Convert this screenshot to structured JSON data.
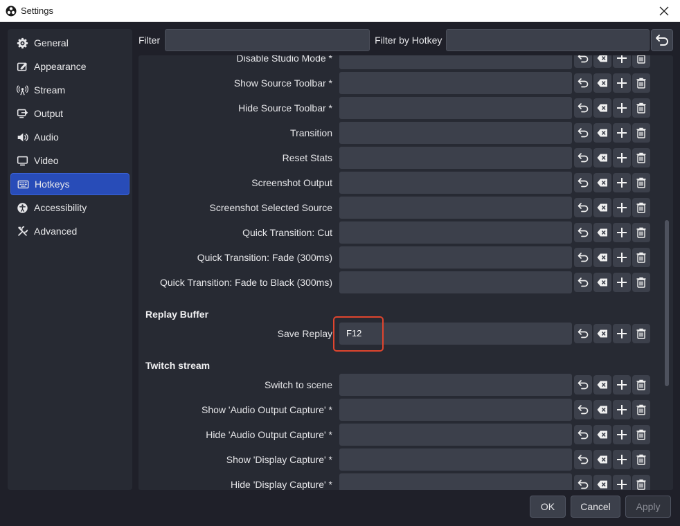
{
  "window": {
    "title": "Settings"
  },
  "sidebar": {
    "items": [
      {
        "label": "General",
        "icon": "gear-icon"
      },
      {
        "label": "Appearance",
        "icon": "appearance-icon"
      },
      {
        "label": "Stream",
        "icon": "broadcast-icon"
      },
      {
        "label": "Output",
        "icon": "output-icon"
      },
      {
        "label": "Audio",
        "icon": "speaker-icon"
      },
      {
        "label": "Video",
        "icon": "monitor-icon"
      },
      {
        "label": "Hotkeys",
        "icon": "keyboard-icon",
        "active": true
      },
      {
        "label": "Accessibility",
        "icon": "accessibility-icon"
      },
      {
        "label": "Advanced",
        "icon": "wrench-icon"
      }
    ]
  },
  "filter": {
    "label": "Filter",
    "value": "",
    "hotkey_label": "Filter by Hotkey",
    "hotkey_value": ""
  },
  "hotkeys": {
    "rows_top": [
      {
        "name": "Disable Studio Mode *",
        "value": ""
      },
      {
        "name": "Show Source Toolbar *",
        "value": ""
      },
      {
        "name": "Hide Source Toolbar *",
        "value": ""
      },
      {
        "name": "Transition",
        "value": ""
      },
      {
        "name": "Reset Stats",
        "value": ""
      },
      {
        "name": "Screenshot Output",
        "value": ""
      },
      {
        "name": "Screenshot Selected Source",
        "value": ""
      },
      {
        "name": "Quick Transition: Cut",
        "value": ""
      },
      {
        "name": "Quick Transition: Fade (300ms)",
        "value": ""
      },
      {
        "name": "Quick Transition: Fade to Black (300ms)",
        "value": ""
      }
    ],
    "replay_section": "Replay Buffer",
    "replay_row": {
      "name": "Save Replay",
      "value": "F12"
    },
    "twitch_section": "Twitch stream",
    "rows_twitch": [
      {
        "name": "Switch to scene",
        "value": ""
      },
      {
        "name": "Show 'Audio Output Capture' *",
        "value": ""
      },
      {
        "name": "Hide 'Audio Output Capture' *",
        "value": ""
      },
      {
        "name": "Show 'Display Capture' *",
        "value": ""
      },
      {
        "name": "Hide 'Display Capture' *",
        "value": ""
      }
    ]
  },
  "buttons": {
    "ok": "OK",
    "cancel": "Cancel",
    "apply": "Apply"
  },
  "colors": {
    "accent": "#284cb8",
    "highlight": "#e0452e",
    "panel": "#272a33",
    "field": "#3c404b"
  }
}
